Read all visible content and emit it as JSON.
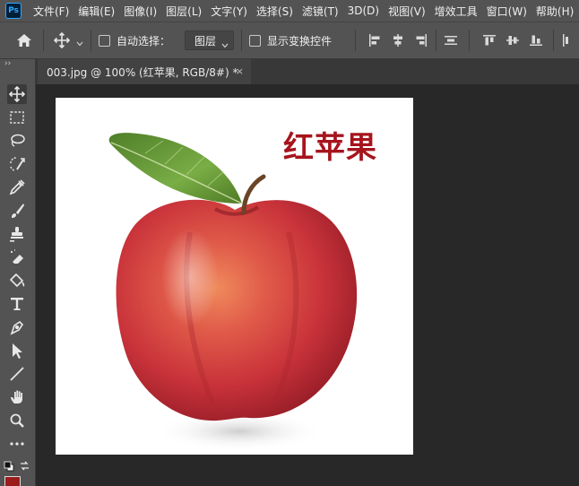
{
  "app": {
    "logo": "Ps"
  },
  "menu": [
    "文件(F)",
    "编辑(E)",
    "图像(I)",
    "图层(L)",
    "文字(Y)",
    "选择(S)",
    "滤镜(T)",
    "3D(D)",
    "视图(V)",
    "增效工具",
    "窗口(W)",
    "帮助(H)"
  ],
  "options": {
    "auto_select_label": "自动选择：",
    "auto_select_target": "图层",
    "show_transform_label": "显示变换控件"
  },
  "document": {
    "tab_title": "003.jpg @ 100% (红苹果, RGB/8#) *",
    "close_glyph": "×",
    "canvas_text": "红苹果"
  },
  "toolbar": {
    "collapse_glyph": "››",
    "foreground_color": "#9b1c1c",
    "background_color": "#ffffff"
  },
  "colors": {
    "title_red": "#a6141d",
    "apple_red": "#cf3b3f",
    "leaf_green": "#6a9e3a"
  }
}
